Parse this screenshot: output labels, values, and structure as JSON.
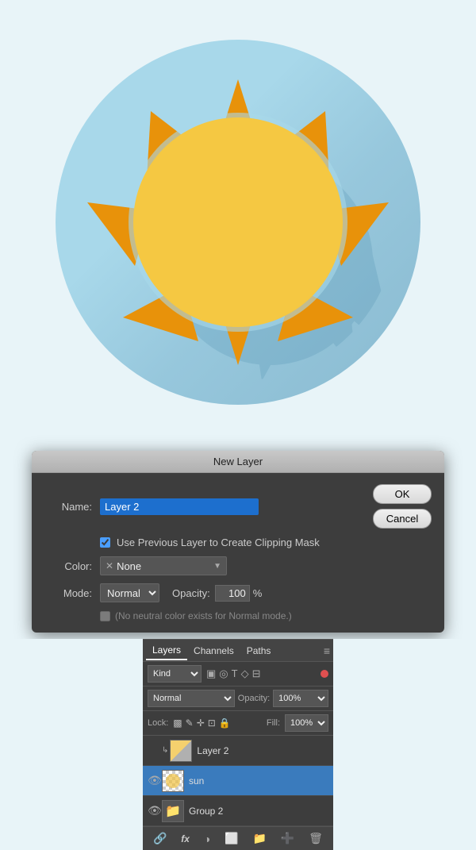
{
  "canvas": {
    "background": "#e8f4f8"
  },
  "dialog": {
    "title": "New Layer",
    "name_label": "Name:",
    "name_value": "Layer 2",
    "ok_label": "OK",
    "cancel_label": "Cancel",
    "checkbox_label": "Use Previous Layer to Create Clipping Mask",
    "color_label": "Color:",
    "color_value": "None",
    "mode_label": "Mode:",
    "mode_value": "Normal",
    "opacity_label": "Opacity:",
    "opacity_value": "100",
    "opacity_unit": "%",
    "neutral_text": "(No neutral color exists for Normal mode.)"
  },
  "layers_panel": {
    "tabs": [
      "Layers",
      "Channels",
      "Paths"
    ],
    "active_tab": "Layers",
    "kind_label": "Kind",
    "normal_label": "Normal",
    "opacity_label": "Opacity:",
    "opacity_value": "100%",
    "lock_label": "Lock:",
    "fill_label": "Fill:",
    "fill_value": "100%",
    "layers": [
      {
        "name": "Layer 2",
        "visible": false,
        "active": false,
        "type": "layer2"
      },
      {
        "name": "sun",
        "visible": true,
        "active": true,
        "type": "sun"
      },
      {
        "name": "Group 2",
        "visible": true,
        "active": false,
        "type": "group"
      }
    ],
    "bottom_icons": [
      "link",
      "fx",
      "new-adjustment",
      "mask",
      "group",
      "new-layer",
      "trash"
    ]
  }
}
